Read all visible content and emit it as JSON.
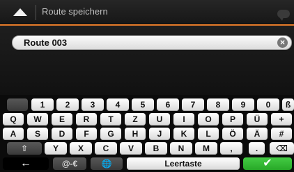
{
  "header": {
    "title": "Route speichern"
  },
  "input": {
    "value": "Route 003"
  },
  "keyboard": {
    "row1": [
      "1",
      "2",
      "3",
      "4",
      "5",
      "6",
      "7",
      "8",
      "9",
      "0",
      "ß"
    ],
    "row2": [
      "Q",
      "W",
      "E",
      "R",
      "T",
      "Z",
      "U",
      "I",
      "O",
      "P",
      "Ü",
      "+"
    ],
    "row3": [
      "A",
      "S",
      "D",
      "F",
      "G",
      "H",
      "J",
      "K",
      "L",
      "Ö",
      "Ä",
      "#"
    ],
    "row4": [
      "Y",
      "X",
      "C",
      "V",
      "B",
      "N",
      "M",
      ",",
      "."
    ],
    "symbols_label": "@-€",
    "space_label": "Leertaste",
    "icons": {
      "back": "back-arrow-icon",
      "shift": "shift-icon",
      "backspace": "backspace-icon",
      "globe": "globe-icon",
      "enter": "checkmark-icon"
    },
    "colors": {
      "accent": "#e87c2a",
      "enter": "#2fb12f"
    }
  }
}
